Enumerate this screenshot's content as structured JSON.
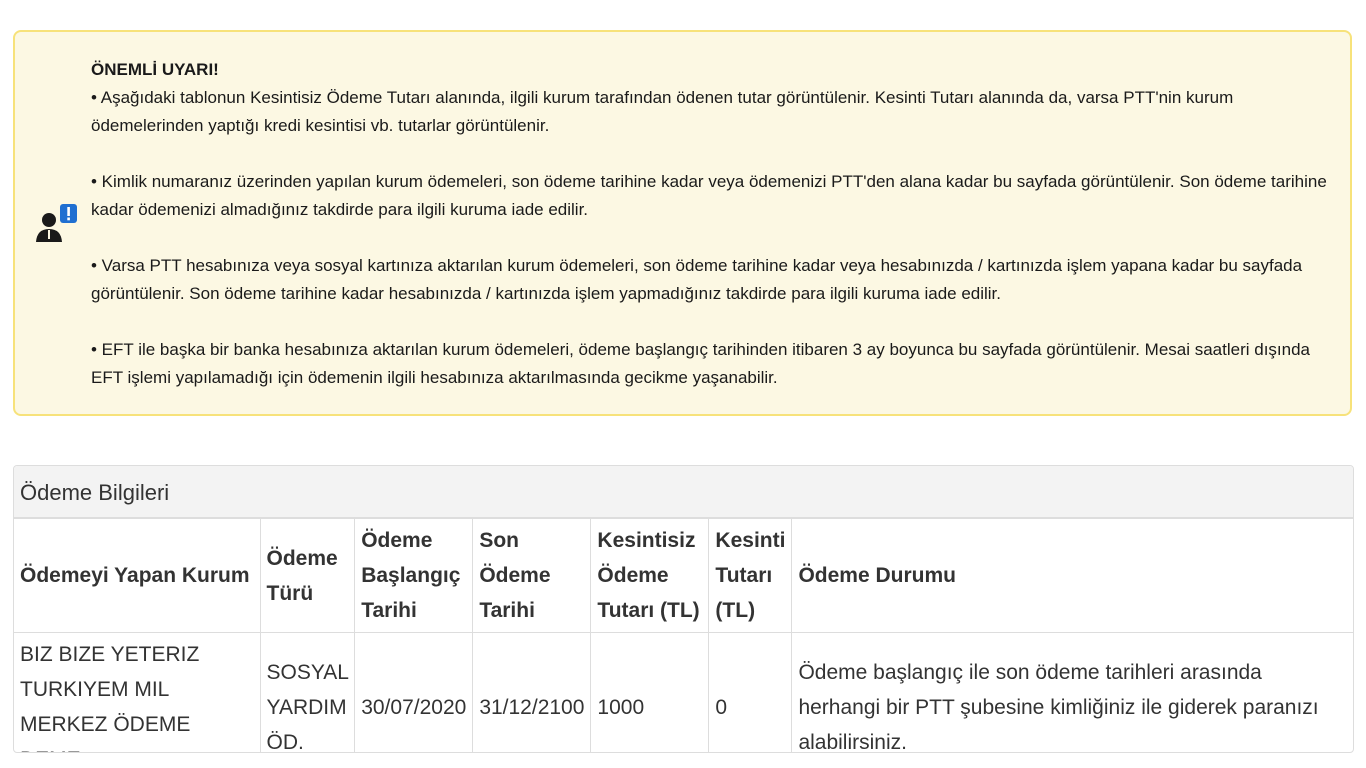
{
  "warning": {
    "title": "ÖNEMLİ UYARI!",
    "paragraphs": [
      "• Aşağıdaki tablonun Kesintisiz Ödeme Tutarı alanında, ilgili kurum tarafından ödenen tutar görüntülenir. Kesinti Tutarı alanında da, varsa PTT'nin kurum ödemelerinden yaptığı kredi kesintisi vb. tutarlar görüntülenir.",
      "• Kimlik numaranız üzerinden yapılan kurum ödemeleri, son ödeme tarihine kadar veya ödemenizi PTT'den alana kadar bu sayfada görüntülenir. Son ödeme tarihine kadar ödemenizi almadığınız takdirde para ilgili kuruma iade edilir.",
      "• Varsa PTT hesabınıza veya sosyal kartınıza aktarılan kurum ödemeleri, son ödeme tarihine kadar veya hesabınızda / kartınızda işlem yapana kadar bu sayfada görüntülenir. Son ödeme tarihine kadar hesabınızda / kartınızda işlem yapmadığınız takdirde para ilgili kuruma iade edilir.",
      "• EFT ile başka bir banka hesabınıza aktarılan kurum ödemeleri, ödeme başlangıç tarihinden itibaren 3 ay boyunca bu sayfada görüntülenir. Mesai saatleri dışında EFT işlemi yapılamadığı için ödemenin ilgili hesabınıza aktarılmasında gecikme yaşanabilir."
    ],
    "icon": "user-alert-icon",
    "colors": {
      "background": "#fcf8e3",
      "border": "#f7e27a",
      "badge": "#1f6fd1"
    }
  },
  "payment_panel": {
    "heading": "Ödeme Bilgileri",
    "columns": [
      "Ödemeyi Yapan Kurum",
      "Ödeme Türü",
      "Ödeme Başlangıç Tarihi",
      "Son Ödeme Tarihi",
      "Kesintisiz Ödeme Tutarı (TL)",
      "Kesinti Tutarı (TL)",
      "Ödeme Durumu"
    ],
    "rows": [
      {
        "institution": "BIZ BIZE YETERIZ TURKIYEM MIL MERKEZ ÖDEME DEME",
        "type": "SOSYAL YARDIM ÖD.",
        "start_date": "30/07/2020",
        "end_date": "31/12/2100",
        "gross_amount": "1000",
        "deduction": "0",
        "status": "Ödeme başlangıç ile son ödeme tarihleri arasında herhangi bir PTT şubesine kimliğiniz ile giderek paranızı alabilirsiniz."
      }
    ]
  }
}
